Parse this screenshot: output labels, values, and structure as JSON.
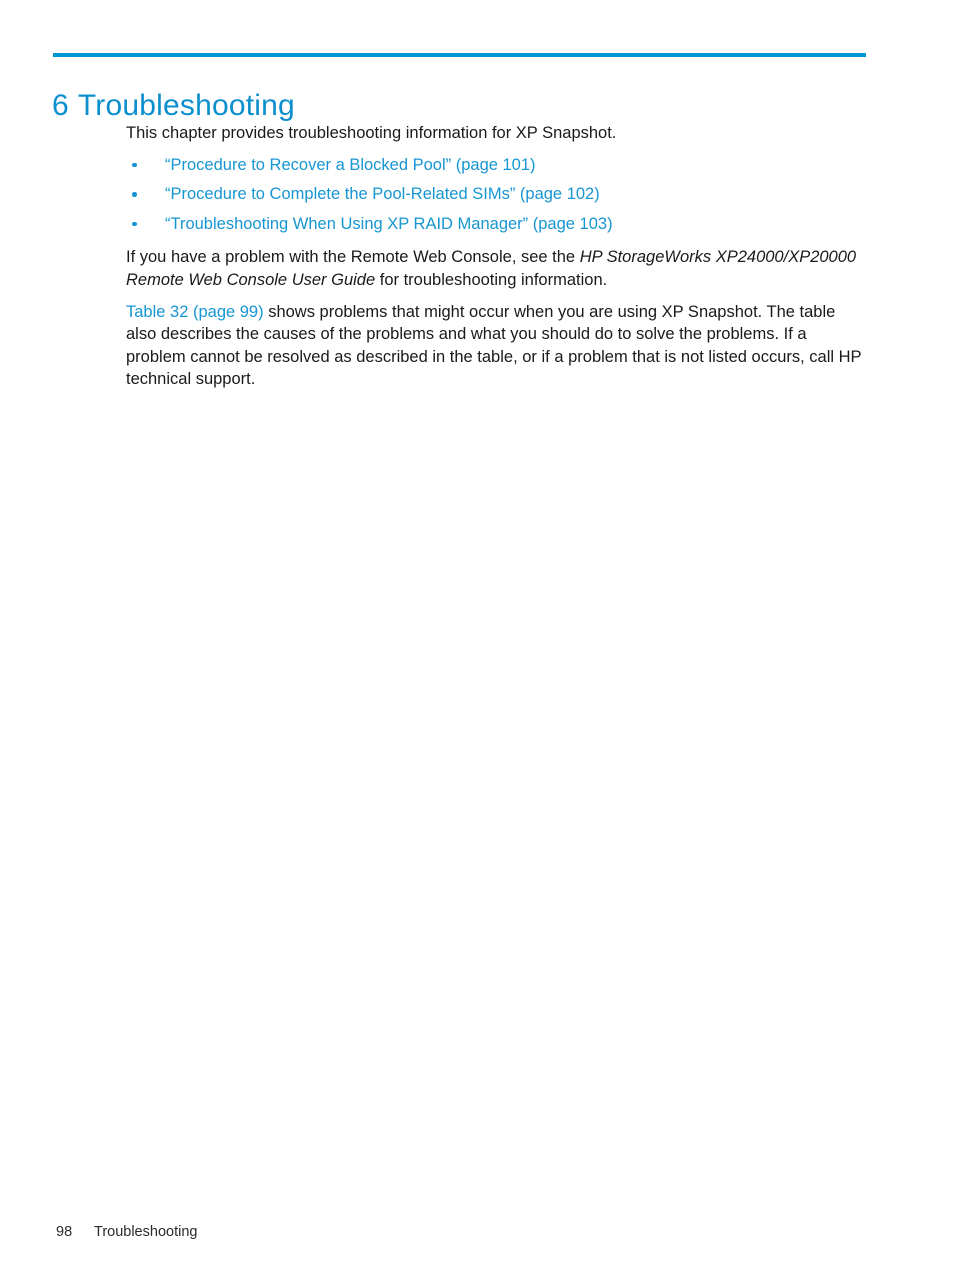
{
  "document": {
    "chapter_number": "6",
    "chapter_title": "Troubleshooting",
    "accent_color": "#0096d6",
    "link_color": "#1696d2",
    "text_color": "#1a1a1a"
  },
  "intro": {
    "text": "This chapter provides troubleshooting information for XP Snapshot."
  },
  "bullets": [
    {
      "label": "“Procedure to Recover a Blocked Pool” (page 101)"
    },
    {
      "label": "“Procedure to Complete the Pool-Related SIMs” (page 102)"
    },
    {
      "label": "“Troubleshooting When Using XP RAID Manager” (page 103)"
    }
  ],
  "console_para": {
    "lead": "If you have a problem with the Remote Web Console, see the ",
    "book_title": "HP StorageWorks XP24000/XP20000 Remote Web Console User Guide",
    "tail": " for troubleshooting information."
  },
  "table_para": {
    "xref": "Table 32 (page 99)",
    "text": " shows problems that might occur when you are using XP Snapshot. The table also describes the causes of the problems and what you should do to solve the problems. If a problem cannot be resolved as described in the table, or if a problem that is not listed occurs, call HP technical support."
  },
  "footer": {
    "page_number": "98",
    "section_name": "Troubleshooting"
  }
}
